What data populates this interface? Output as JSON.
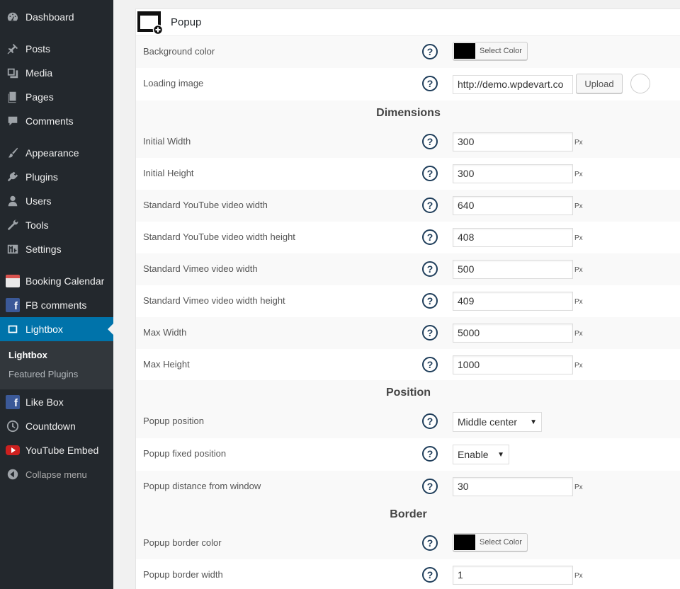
{
  "sidebar": {
    "items": [
      {
        "label": "Dashboard",
        "icon": "dashboard-icon"
      },
      {
        "label": "Posts",
        "icon": "pin-icon"
      },
      {
        "label": "Media",
        "icon": "media-icon"
      },
      {
        "label": "Pages",
        "icon": "pages-icon"
      },
      {
        "label": "Comments",
        "icon": "comment-icon"
      },
      {
        "label": "Appearance",
        "icon": "brush-icon"
      },
      {
        "label": "Plugins",
        "icon": "plug-icon"
      },
      {
        "label": "Users",
        "icon": "user-icon"
      },
      {
        "label": "Tools",
        "icon": "wrench-icon"
      },
      {
        "label": "Settings",
        "icon": "settings-icon"
      },
      {
        "label": "Booking Calendar",
        "icon": "calendar-icon"
      },
      {
        "label": "FB comments",
        "icon": "facebook-icon"
      },
      {
        "label": "Lightbox",
        "icon": "lightbox-icon"
      },
      {
        "label": "Like Box",
        "icon": "facebook-icon"
      },
      {
        "label": "Countdown",
        "icon": "clock-icon"
      },
      {
        "label": "YouTube Embed",
        "icon": "youtube-icon"
      },
      {
        "label": "Collapse menu",
        "icon": "collapse-icon"
      }
    ],
    "submenu": [
      "Lightbox",
      "Featured Plugins"
    ],
    "accent": "#0073aa"
  },
  "panel": {
    "title": "Popup",
    "help_glyph": "?",
    "unit": "Px",
    "color_button_label": "Select Color",
    "background_color": {
      "label": "Background color",
      "value": "#000000"
    },
    "loading_image": {
      "label": "Loading image",
      "value": "http://demo.wpdevart.co",
      "button": "Upload"
    },
    "sections": {
      "dimensions": "Dimensions",
      "position": "Position",
      "border": "Border"
    },
    "dimensions": [
      {
        "label": "Initial Width",
        "value": "300"
      },
      {
        "label": "Initial Height",
        "value": "300"
      },
      {
        "label": "Standard YouTube video width",
        "value": "640"
      },
      {
        "label": "Standard YouTube video width height",
        "value": "408"
      },
      {
        "label": "Standard Vimeo video width",
        "value": "500"
      },
      {
        "label": "Standard Vimeo video width height",
        "value": "409"
      },
      {
        "label": "Max Width",
        "value": "5000"
      },
      {
        "label": "Max Height",
        "value": "1000"
      }
    ],
    "position": {
      "popup_position": {
        "label": "Popup position",
        "value": "Middle center"
      },
      "fixed_position": {
        "label": "Popup fixed position",
        "value": "Enable"
      },
      "distance": {
        "label": "Popup distance from window",
        "value": "30"
      }
    },
    "border": {
      "color": {
        "label": "Popup border color",
        "value": "#000000"
      },
      "width": {
        "label": "Popup border width",
        "value": "1"
      }
    }
  }
}
